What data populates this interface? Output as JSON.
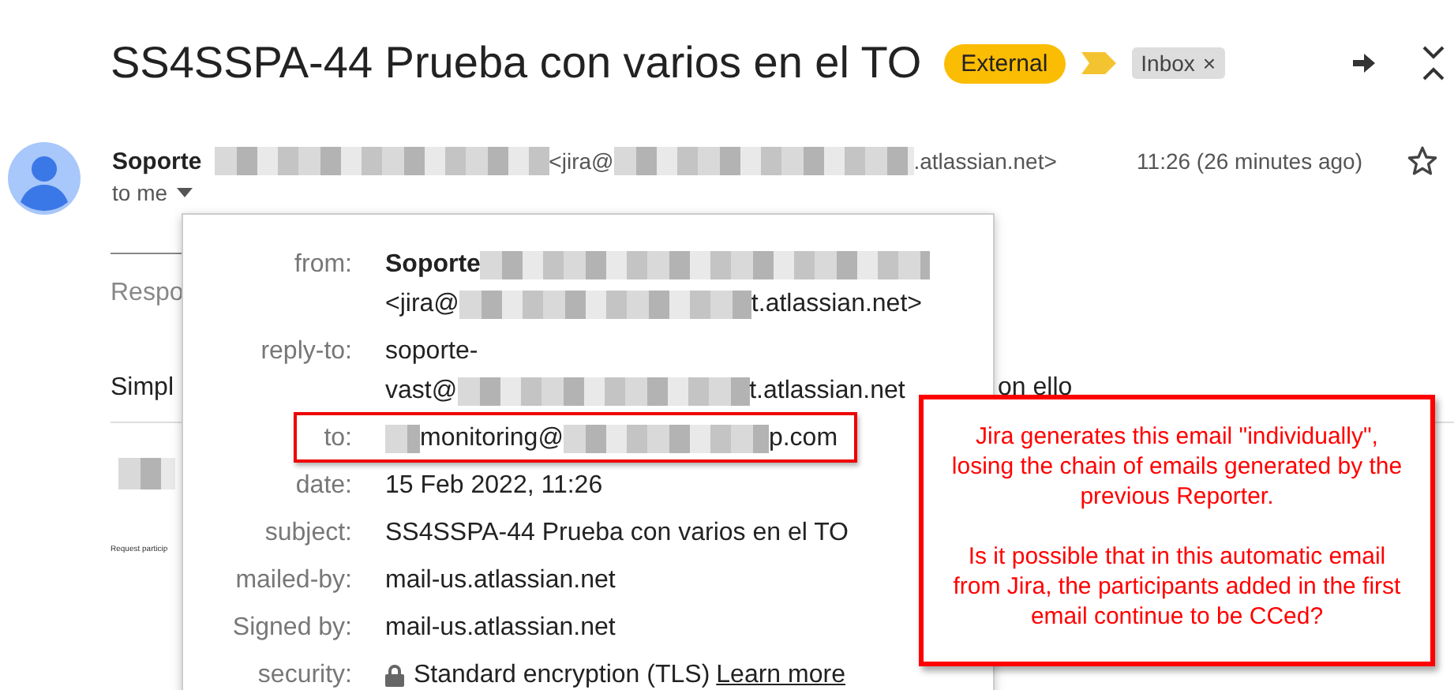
{
  "subject": "SS4SSPA-44 Prueba con varios en el TO",
  "labels": [
    {
      "kind": "external",
      "text": "External"
    },
    {
      "kind": "importance"
    },
    {
      "kind": "folder",
      "text": "Inbox",
      "close": "×"
    }
  ],
  "sender": {
    "name": "Soporte",
    "address_start": "<jira@",
    "address_end": ".atlassian.net>"
  },
  "time": "11:26 (26 minutes ago)",
  "starred": false,
  "recipient": "to me",
  "behind": {
    "reply_line": "Respo",
    "body_start": "Simpl",
    "body_end": "on ello",
    "attachment_caption": "Request particip"
  },
  "details": [
    {
      "label": "from:",
      "highlighted": false,
      "lines": [
        [
          {
            "kind": "text",
            "text": "Soporte",
            "bold": true
          },
          {
            "kind": "redacted"
          }
        ],
        [
          {
            "kind": "text",
            "text": "<jira@"
          },
          {
            "kind": "redacted"
          },
          {
            "kind": "text",
            "text": "t.atlassian.net>"
          }
        ]
      ]
    },
    {
      "label": "reply-to:",
      "highlighted": false,
      "lines": [
        [
          {
            "kind": "text",
            "text": "soporte-"
          }
        ],
        [
          {
            "kind": "text",
            "text": "vast@"
          },
          {
            "kind": "redacted"
          },
          {
            "kind": "text",
            "text": "t.atlassian.net"
          }
        ]
      ]
    },
    {
      "label": "to:",
      "highlighted": true,
      "lines": [
        [
          {
            "kind": "redacted"
          },
          {
            "kind": "text",
            "text": "monitoring@"
          },
          {
            "kind": "redacted"
          },
          {
            "kind": "text",
            "text": "p.com"
          }
        ]
      ]
    },
    {
      "label": "date:",
      "highlighted": false,
      "lines": [
        [
          {
            "kind": "text",
            "text": "15 Feb 2022, 11:26"
          }
        ]
      ]
    },
    {
      "label": "subject:",
      "highlighted": false,
      "lines": [
        [
          {
            "kind": "text",
            "text": "SS4SSPA-44 Prueba con varios en el TO"
          }
        ]
      ]
    },
    {
      "label": "mailed-by:",
      "highlighted": false,
      "lines": [
        [
          {
            "kind": "text",
            "text": "mail-us.atlassian.net"
          }
        ]
      ]
    },
    {
      "label": "Signed by:",
      "highlighted": false,
      "lines": [
        [
          {
            "kind": "text",
            "text": "mail-us.atlassian.net"
          }
        ]
      ]
    },
    {
      "label": "security:",
      "highlighted": false,
      "lines": [
        [
          {
            "kind": "lock"
          },
          {
            "kind": "text",
            "text": "Standard encryption (TLS)"
          },
          {
            "kind": "link",
            "text": "Learn more"
          }
        ]
      ]
    }
  ],
  "callout": {
    "paragraphs": [
      "Jira generates this email \"individually\", losing the chain of emails generated by the previous Reporter.",
      "Is it possible that in this automatic email from Jira, the participants added in the first email continue to be CCed?"
    ]
  }
}
